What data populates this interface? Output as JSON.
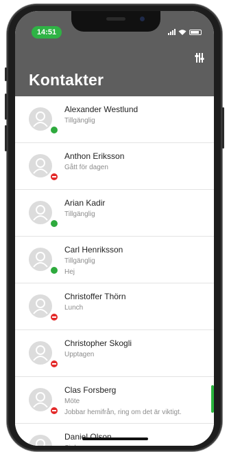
{
  "status_bar": {
    "time": "14:51",
    "time_color": "#2fb345"
  },
  "header": {
    "title": "Kontakter",
    "background": "#5e5e5e",
    "filter_icon": "filter-icon"
  },
  "presence_colors": {
    "available": "#2eaa3d",
    "busy": "#e32a2a"
  },
  "contacts": [
    {
      "name": "Alexander Westlund",
      "status": "Tillgänglig",
      "note": "",
      "presence": "available"
    },
    {
      "name": "Anthon Eriksson",
      "status": "Gått för dagen",
      "note": "",
      "presence": "busy"
    },
    {
      "name": "Arian Kadir",
      "status": "Tillgänglig",
      "note": "",
      "presence": "available"
    },
    {
      "name": "Carl Henriksson",
      "status": "Tillgänglig",
      "note": "Hej",
      "presence": "available"
    },
    {
      "name": "Christoffer Thörn",
      "status": "Lunch",
      "note": "",
      "presence": "busy"
    },
    {
      "name": "Christopher Skogli",
      "status": "Upptagen",
      "note": "",
      "presence": "busy"
    },
    {
      "name": "Clas Forsberg",
      "status": "Möte",
      "note": "Jobbar hemifrån, ring om det är viktigt.",
      "presence": "busy"
    },
    {
      "name": "Daniel Olson",
      "status": "Sjuk",
      "note": "",
      "presence": "busy"
    }
  ]
}
